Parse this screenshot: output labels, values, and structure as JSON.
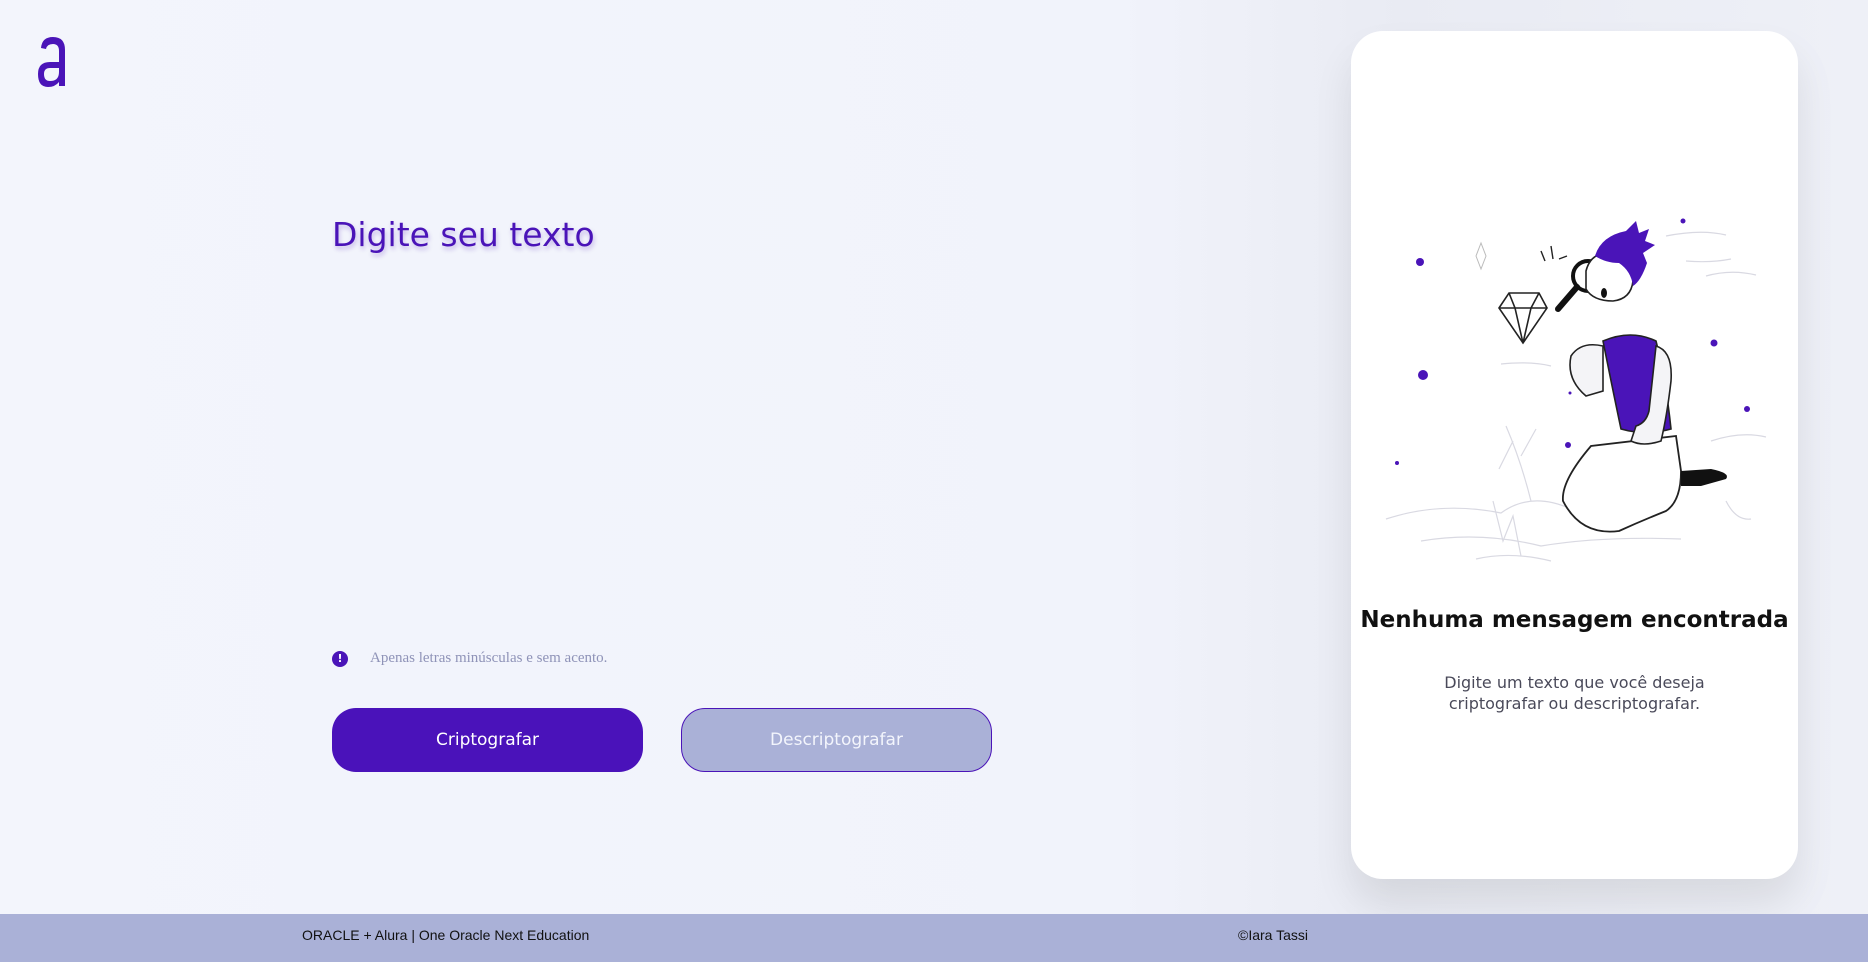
{
  "brand": {
    "logo_icon": "alura-logo-icon",
    "accent_color": "#4a14b8"
  },
  "input_area": {
    "placeholder": "Digite seu texto",
    "value": ""
  },
  "hint": {
    "icon": "exclamation-circle-icon",
    "text": "Apenas letras minúsculas e sem acento."
  },
  "buttons": {
    "encrypt_label": "Criptografar",
    "decrypt_label": "Descriptografar"
  },
  "output_panel": {
    "illustration": "person-with-magnifying-glass-illustration",
    "title": "Nenhuma mensagem encontrada",
    "description": "Digite um texto que você deseja criptografar ou descriptografar."
  },
  "footer": {
    "left_text": "ORACLE + Alura | One Oracle Next Education",
    "right_text": "©Iara Tassi"
  }
}
